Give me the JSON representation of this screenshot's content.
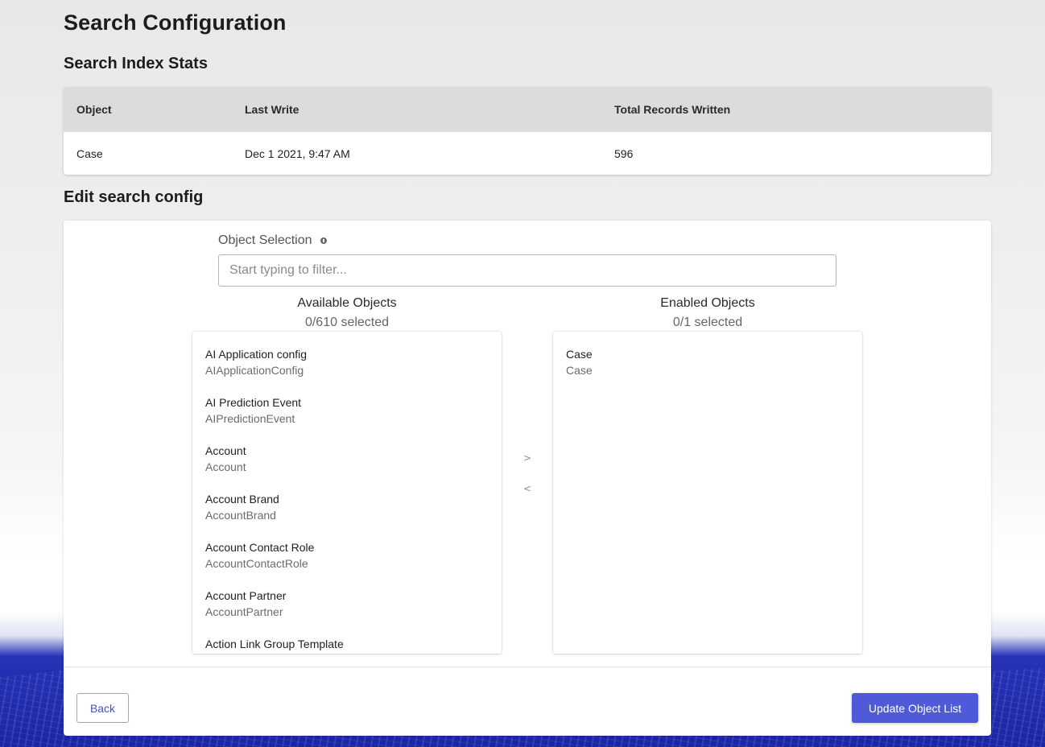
{
  "page": {
    "title": "Search Configuration"
  },
  "stats": {
    "title": "Search Index Stats",
    "columns": [
      "Object",
      "Last Write",
      "Total Records Written"
    ],
    "rows": [
      {
        "object": "Case",
        "last_write": "Dec 1 2021, 9:47 AM",
        "total": "596"
      }
    ]
  },
  "edit": {
    "title": "Edit search config",
    "object_selection_label": "Object Selection",
    "filter_placeholder": "Start typing to filter...",
    "filter_value": "",
    "available": {
      "title": "Available Objects",
      "count": "0/610 selected",
      "items": [
        {
          "label": "AI Application config",
          "api": "AIApplicationConfig"
        },
        {
          "label": "AI Prediction Event",
          "api": "AIPredictionEvent"
        },
        {
          "label": "Account",
          "api": "Account"
        },
        {
          "label": "Account Brand",
          "api": "AccountBrand"
        },
        {
          "label": "Account Contact Role",
          "api": "AccountContactRole"
        },
        {
          "label": "Account Partner",
          "api": "AccountPartner"
        },
        {
          "label": "Action Link Group Template",
          "api": ""
        }
      ]
    },
    "enabled": {
      "title": "Enabled Objects",
      "count": "0/1 selected",
      "items": [
        {
          "label": "Case",
          "api": "Case"
        }
      ]
    },
    "move_right": ">",
    "move_left": "<",
    "back_label": "Back",
    "update_label": "Update Object List"
  },
  "colors": {
    "primary": "#4f5ad8",
    "header_bg": "#dcdcdc",
    "backdrop": "#2530b4"
  },
  "icons": {
    "info": "info-icon"
  }
}
